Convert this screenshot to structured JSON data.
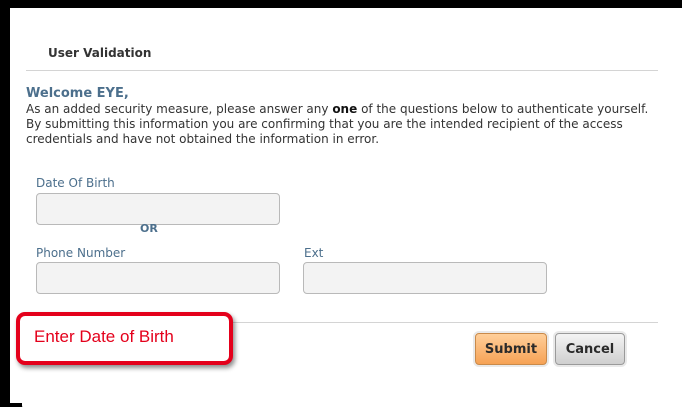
{
  "dialog": {
    "title": "User Validation",
    "welcome": "Welcome EYE,",
    "intro_before": "As an added security measure, please answer any ",
    "intro_bold": "one",
    "intro_after": " of the questions below to authenticate yourself. By submitting this information you are confirming that you are the intended recipient of the access credentials and have not obtained the information in error."
  },
  "form": {
    "dob_label": "Date Of Birth",
    "dob_value": "",
    "or_label": "OR",
    "phone_label": "Phone Number",
    "phone_value": "",
    "ext_label": "Ext",
    "ext_value": ""
  },
  "annotation": {
    "callout_text": "Enter Date of Birth",
    "color": "#e4001b"
  },
  "buttons": {
    "submit_label": "Submit",
    "cancel_label": "Cancel",
    "submit_color": "#f6a255"
  }
}
